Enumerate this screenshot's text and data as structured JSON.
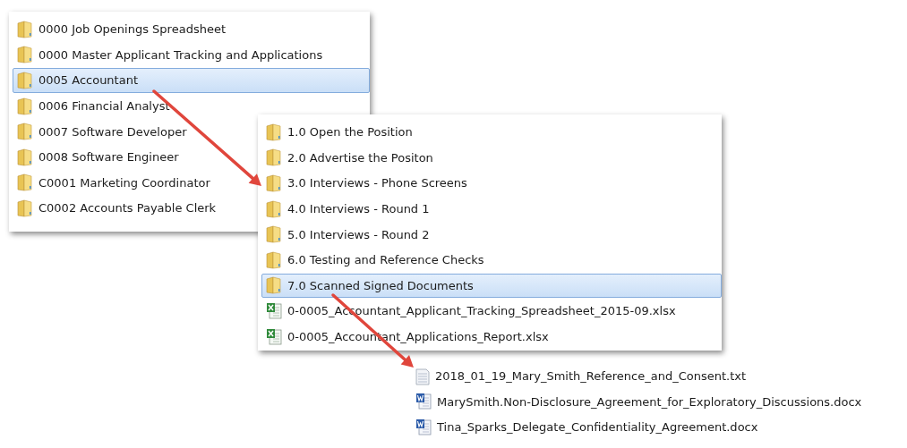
{
  "panels": [
    {
      "items": [
        {
          "kind": "folder",
          "name": "0000 Job Openings Spreadsheet",
          "selected": false
        },
        {
          "kind": "folder",
          "name": "0000 Master Applicant Tracking and Applications",
          "selected": false
        },
        {
          "kind": "folder",
          "name": "0005 Accountant",
          "selected": true
        },
        {
          "kind": "folder",
          "name": "0006 Financial Analyst",
          "selected": false
        },
        {
          "kind": "folder",
          "name": "0007 Software Developer",
          "selected": false
        },
        {
          "kind": "folder",
          "name": "0008 Software Engineer",
          "selected": false
        },
        {
          "kind": "folder",
          "name": "C0001 Marketing Coordinator",
          "selected": false
        },
        {
          "kind": "folder",
          "name": "C0002 Accounts Payable Clerk",
          "selected": false
        }
      ]
    },
    {
      "items": [
        {
          "kind": "folder",
          "name": "1.0 Open the Position",
          "selected": false
        },
        {
          "kind": "folder",
          "name": "2.0 Advertise the Positon",
          "selected": false
        },
        {
          "kind": "folder",
          "name": "3.0 Interviews - Phone Screens",
          "selected": false
        },
        {
          "kind": "folder",
          "name": "4.0 Interviews - Round 1",
          "selected": false
        },
        {
          "kind": "folder",
          "name": "5.0 Interviews - Round 2",
          "selected": false
        },
        {
          "kind": "folder",
          "name": "6.0 Testing and Reference Checks",
          "selected": false
        },
        {
          "kind": "folder",
          "name": "7.0 Scanned Signed Documents",
          "selected": true
        },
        {
          "kind": "excel",
          "name": "0-0005_Accountant_Applicant_Tracking_Spreadsheet_2015-09.xlsx",
          "selected": false
        },
        {
          "kind": "excel",
          "name": "0-0005_Accountant_Applications_Report.xlsx",
          "selected": false
        }
      ]
    },
    {
      "items": [
        {
          "kind": "text",
          "name": "2018_01_19_Mary_Smith_Reference_and_Consent.txt",
          "selected": false
        },
        {
          "kind": "word",
          "name": "MarySmith.Non-Disclosure_Agreement_for_Exploratory_Discussions.docx",
          "selected": false
        },
        {
          "kind": "word",
          "name": "Tina_Sparks_Delegate_Confidentiality_Agreement.docx",
          "selected": false
        }
      ]
    }
  ]
}
